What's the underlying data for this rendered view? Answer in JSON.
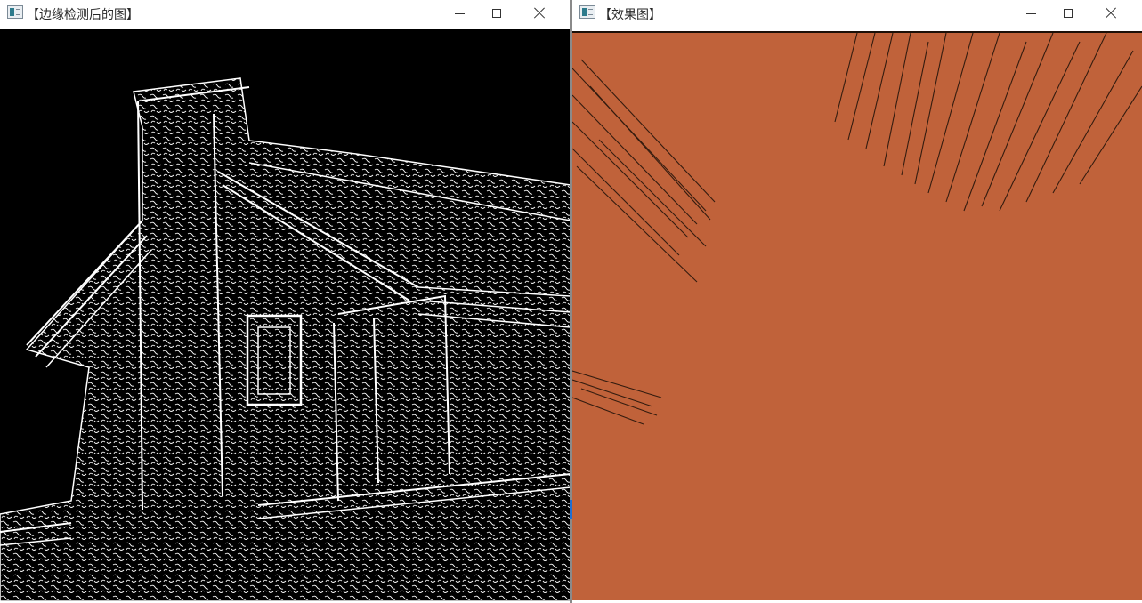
{
  "left_window": {
    "title": "【边缘检测后的图】",
    "icon": "opencv-window-icon",
    "controls": {
      "minimize": "minimize-icon",
      "maximize": "maximize-icon",
      "close": "close-icon"
    },
    "image": {
      "description_tag": "edge-detected-image",
      "background": "#000000",
      "edge_color": "#ffffff"
    }
  },
  "right_window": {
    "title": "【效果图】",
    "icon": "opencv-window-icon",
    "controls": {
      "minimize": "minimize-icon",
      "maximize": "maximize-icon",
      "close": "close-icon"
    },
    "image": {
      "description_tag": "effect-image",
      "background": "#c0623a",
      "streak_color": "#1c1008"
    }
  }
}
